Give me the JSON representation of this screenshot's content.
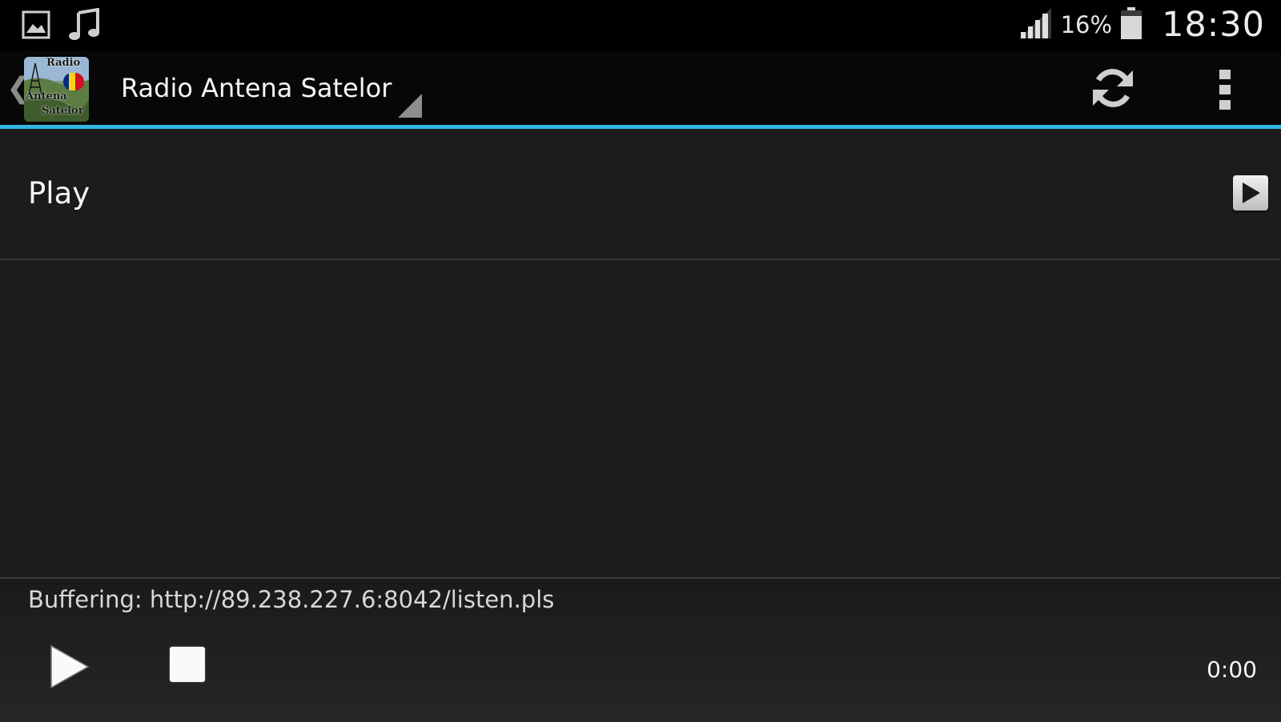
{
  "status_bar": {
    "battery_percent": "16%",
    "time": "18:30",
    "notification_icons": [
      "image-icon",
      "music-note-icon"
    ],
    "signal_icon": "signal-bars-icon",
    "battery_icon": "battery-icon"
  },
  "action_bar": {
    "title": "Radio Antena Satelor",
    "back_icon": "chevron-left-icon",
    "logo_text": [
      "Radio",
      "Antena",
      "Satelor"
    ],
    "actions": [
      "refresh-icon",
      "overflow-menu-icon"
    ],
    "accent_color": "#33b5e5"
  },
  "list": {
    "items": [
      {
        "label": "Play",
        "icon": "play-icon"
      }
    ]
  },
  "player": {
    "status": "Buffering: http://89.238.227.6:8042/listen.pls",
    "elapsed": "0:00",
    "controls": [
      "play-icon",
      "stop-icon"
    ]
  }
}
